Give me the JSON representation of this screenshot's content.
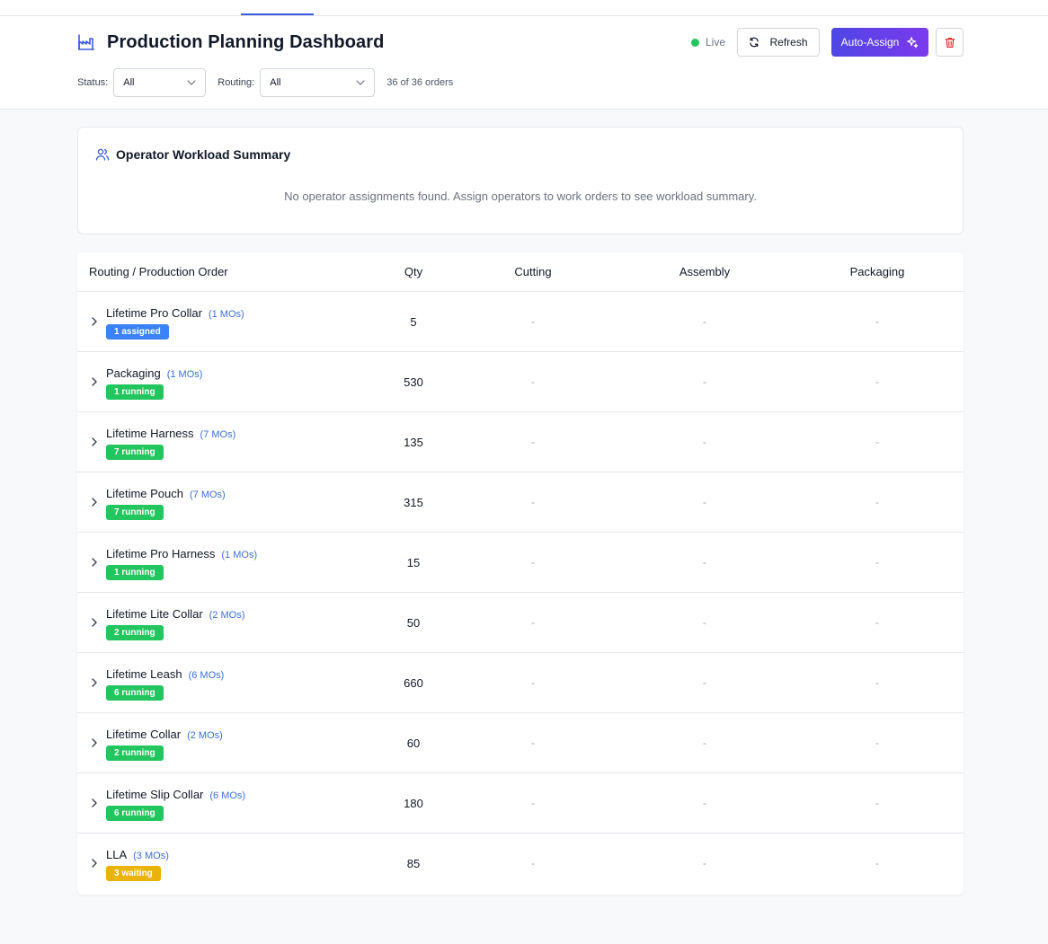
{
  "header": {
    "title": "Production Planning Dashboard",
    "live_label": "Live",
    "refresh_label": "Refresh",
    "auto_assign_label": "Auto-Assign",
    "icon": "factory-icon"
  },
  "filters": {
    "status_label": "Status:",
    "status_value": "All",
    "routing_label": "Routing:",
    "routing_value": "All",
    "order_count": "36 of 36 orders"
  },
  "workload": {
    "title": "Operator Workload Summary",
    "empty_message": "No operator assignments found. Assign operators to work orders to see workload summary."
  },
  "table": {
    "columns": [
      "Routing / Production Order",
      "Qty",
      "Cutting",
      "Assembly",
      "Packaging"
    ],
    "rows": [
      {
        "name": "Lifetime Pro Collar",
        "mos": "(1 MOs)",
        "badge": "1 assigned",
        "badge_type": "assigned",
        "qty": "5",
        "cutting": "-",
        "assembly": "-",
        "packaging": "-"
      },
      {
        "name": "Packaging",
        "mos": "(1 MOs)",
        "badge": "1 running",
        "badge_type": "running",
        "qty": "530",
        "cutting": "-",
        "assembly": "-",
        "packaging": "-"
      },
      {
        "name": "Lifetime Harness",
        "mos": "(7 MOs)",
        "badge": "7 running",
        "badge_type": "running",
        "qty": "135",
        "cutting": "-",
        "assembly": "-",
        "packaging": "-"
      },
      {
        "name": "Lifetime Pouch",
        "mos": "(7 MOs)",
        "badge": "7 running",
        "badge_type": "running",
        "qty": "315",
        "cutting": "-",
        "assembly": "-",
        "packaging": "-"
      },
      {
        "name": "Lifetime Pro Harness",
        "mos": "(1 MOs)",
        "badge": "1 running",
        "badge_type": "running",
        "qty": "15",
        "cutting": "-",
        "assembly": "-",
        "packaging": "-"
      },
      {
        "name": "Lifetime Lite Collar",
        "mos": "(2 MOs)",
        "badge": "2 running",
        "badge_type": "running",
        "qty": "50",
        "cutting": "-",
        "assembly": "-",
        "packaging": "-"
      },
      {
        "name": "Lifetime Leash",
        "mos": "(6 MOs)",
        "badge": "6 running",
        "badge_type": "running",
        "qty": "660",
        "cutting": "-",
        "assembly": "-",
        "packaging": "-"
      },
      {
        "name": "Lifetime Collar",
        "mos": "(2 MOs)",
        "badge": "2 running",
        "badge_type": "running",
        "qty": "60",
        "cutting": "-",
        "assembly": "-",
        "packaging": "-"
      },
      {
        "name": "Lifetime Slip Collar",
        "mos": "(6 MOs)",
        "badge": "6 running",
        "badge_type": "running",
        "qty": "180",
        "cutting": "-",
        "assembly": "-",
        "packaging": "-"
      },
      {
        "name": "LLA",
        "mos": "(3 MOs)",
        "badge": "3 waiting",
        "badge_type": "waiting",
        "qty": "85",
        "cutting": "-",
        "assembly": "-",
        "packaging": "-"
      }
    ]
  },
  "colors": {
    "accent": "#3b5bdb",
    "live": "#22c55e",
    "assigned": "#3b82f6",
    "running": "#22c55e",
    "waiting": "#eab308",
    "delete": "#dc2626"
  }
}
